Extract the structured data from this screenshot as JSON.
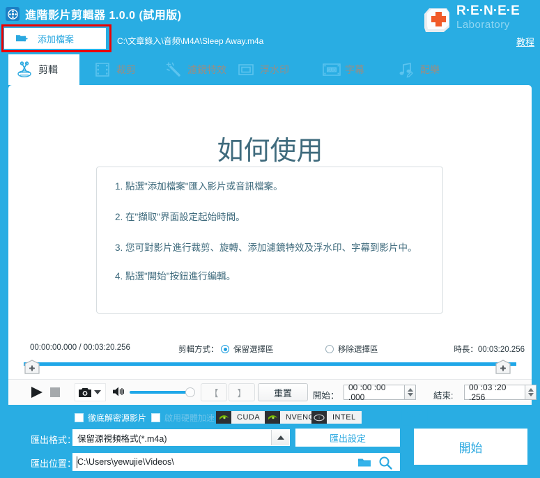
{
  "window": {
    "title": "進階影片剪輯器 1.0.0 (試用版)",
    "app_icon": "film-reel-icon"
  },
  "toolbar": {
    "add_file_label": "添加檔案",
    "add_file_icon": "add-folder-icon",
    "file_path": "C:\\文章錄入\\音频\\M4A\\Sleep Away.m4a",
    "highlight_color": "#ee0000"
  },
  "brand": {
    "name": "R·E·N·E·E",
    "sub": "Laboratory",
    "icon": "keyboard-key-plus-icon",
    "tutorial_label": "教程"
  },
  "tabs": [
    {
      "label": "剪輯",
      "icon": "scissors-icon",
      "active": true
    },
    {
      "label": "裁剪",
      "icon": "film-crop-icon",
      "active": false
    },
    {
      "label": "濾鏡特效",
      "icon": "magic-wand-icon",
      "active": false
    },
    {
      "label": "浮水印",
      "icon": "watermark-frame-icon",
      "active": false
    },
    {
      "label": "字幕",
      "icon": "subtitle-sub-icon",
      "active": false
    },
    {
      "label": "配樂",
      "icon": "music-note-pencil-icon",
      "active": false
    }
  ],
  "preview": {
    "title": "如何使用",
    "steps": [
      "1. 點選\"添加檔案\"匯入影片或音訊檔案。",
      "2. 在\"擷取\"界面設定起始時間。",
      "3. 您可對影片進行裁剪、旋轉、添加濾鏡特效及浮水印、字幕到影片中。",
      "4. 點選\"開始\"按鈕進行編輯。"
    ],
    "envelope_icon": "envelope-icon"
  },
  "timeline": {
    "current_time": "00:00:00.000 / 00:03:20.256",
    "mode_label": "剪輯方式：",
    "mode_options": [
      {
        "label": "保留選擇區",
        "selected": true
      },
      {
        "label": "移除選擇區",
        "selected": false
      }
    ],
    "duration_label": "時長：",
    "duration_value": "00:03:20.256",
    "track_fill_color": "#1fa7e8",
    "handle_left_icon": "timeline-marker-icon",
    "handle_right_icon": "timeline-marker-icon"
  },
  "controls": {
    "play_icon": "play-icon",
    "stop_icon": "stop-icon",
    "snapshot_icon": "camera-icon",
    "snapshot_arrow_icon": "chevron-down-icon",
    "volume_icon": "volume-icon",
    "volume_value": 100,
    "mark_in_label": "【",
    "mark_out_label": "】",
    "reset_label": "重置",
    "start_time_label": "開始：",
    "start_time_value": "00 :00 :00 .000",
    "end_time_label": "結束:",
    "end_time_value": "00 :03 :20 .256",
    "spinner_icon": "spinner-up-down-icon"
  },
  "options": {
    "checkboxes": [
      {
        "label": "徹底解密源影片",
        "checked": false,
        "disabled": false
      },
      {
        "label": "啟用硬體加速",
        "checked": false,
        "disabled": true
      }
    ],
    "accelerators": [
      {
        "label": "CUDA",
        "icon": "nvidia-icon"
      },
      {
        "label": "NVENC",
        "icon": "nvidia-icon"
      },
      {
        "label": "INTEL",
        "icon": "intel-icon"
      }
    ]
  },
  "export": {
    "format_label": "匯出格式：",
    "format_value": "保留源視頻格式(*.m4a)",
    "format_arrow_icon": "chevron-up-icon",
    "settings_label": "匯出設定",
    "location_label": "匯出位置：",
    "location_value": "C:\\Users\\yewujie\\Videos\\",
    "folder_icon": "folder-icon",
    "search_icon": "search-icon",
    "start_label": "開始"
  },
  "colors": {
    "background": "#29ade3",
    "panel": "#ffffff",
    "accent": "#1fa7e8",
    "tab_inactive_text": "#f0763a",
    "heading": "#3f6b7d"
  }
}
